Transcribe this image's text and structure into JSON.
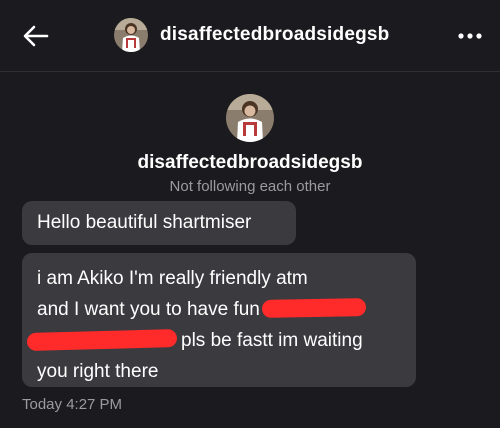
{
  "header": {
    "back_icon": "arrow-left-icon",
    "username": "disaffectedbroadsidegsb",
    "more_icon": "more-horizontal-icon"
  },
  "profile": {
    "name": "disaffectedbroadsidegsb",
    "follow_status": "Not following each other"
  },
  "messages": [
    {
      "lines": [
        "Hello beautiful shartmiser"
      ]
    },
    {
      "line1": "i am Akiko I'm really friendly atm",
      "line2": "and I want you to have fun",
      "line3": "pls be fastt im waiting",
      "line4": "you right there"
    }
  ],
  "timestamp": "Today 4:27 PM",
  "colors": {
    "background": "#1b1b1f",
    "bubble": "#3a3a3f",
    "muted_text": "#9a9aa0",
    "redaction": "#ff2a2a"
  }
}
